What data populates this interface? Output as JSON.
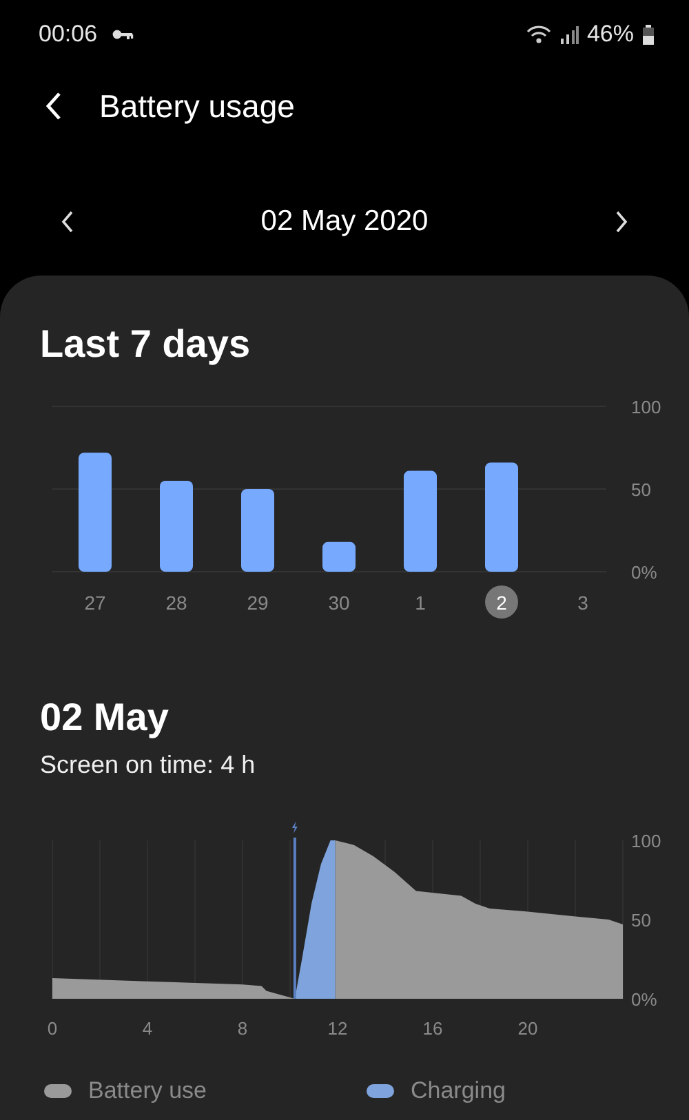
{
  "status_bar": {
    "time": "00:06",
    "battery_text": "46%"
  },
  "header": {
    "title": "Battery usage"
  },
  "date_nav": {
    "date": "02 May 2020"
  },
  "weekly": {
    "title": "Last 7 days",
    "chart_data": {
      "type": "bar",
      "categories": [
        "27",
        "28",
        "29",
        "30",
        "1",
        "2",
        "3"
      ],
      "series": [
        {
          "color": "#77aaff",
          "values": [
            72,
            55,
            50,
            18,
            61,
            66,
            null
          ]
        }
      ],
      "ylim": [
        0,
        100
      ],
      "yticks": [
        {
          "value": 100,
          "label": "100"
        },
        {
          "value": 50,
          "label": "50"
        },
        {
          "value": 0,
          "label": "0%"
        }
      ]
    },
    "day_selection": [
      {
        "selected": false
      },
      {
        "selected": false
      },
      {
        "selected": false
      },
      {
        "selected": false
      },
      {
        "selected": false
      },
      {
        "selected": true
      },
      {
        "selected": false
      }
    ]
  },
  "daily": {
    "title": "02 May",
    "subtitle": "Screen on time: 4 h",
    "chart_data": {
      "type": "area",
      "x": [
        0,
        4,
        8,
        8.8,
        9,
        10.2,
        10.5,
        10.9,
        11.3,
        11.7,
        11.9,
        12.7,
        13.5,
        14.4,
        15.3,
        17.2,
        17.8,
        18.4,
        20,
        22,
        23.4,
        24
      ],
      "series": [
        {
          "name": "Battery use",
          "color": "#9a9a9a",
          "values": [
            13,
            11,
            9,
            8,
            5,
            0,
            null,
            null,
            null,
            null,
            100,
            97,
            90,
            80,
            68,
            65,
            60,
            57,
            55,
            52,
            50,
            47
          ]
        },
        {
          "name": "Charging",
          "color": "#7fa3dc",
          "values": [
            null,
            null,
            null,
            null,
            null,
            0,
            25,
            60,
            85,
            100,
            100,
            null,
            null,
            null,
            null,
            null,
            null,
            null,
            null,
            null,
            null,
            null
          ]
        }
      ],
      "grid": true,
      "ref_lines": [
        {
          "axis": "x",
          "value": 10.2,
          "color": "#5a80c0"
        }
      ],
      "xlim": [
        0,
        24
      ],
      "ylim": [
        0,
        100
      ],
      "xticks": [
        0,
        4,
        8,
        12,
        16,
        20
      ],
      "yticks": [
        {
          "value": 100,
          "label": "100"
        },
        {
          "value": 50,
          "label": "50"
        },
        {
          "value": 0,
          "label": "0%"
        }
      ]
    }
  }
}
